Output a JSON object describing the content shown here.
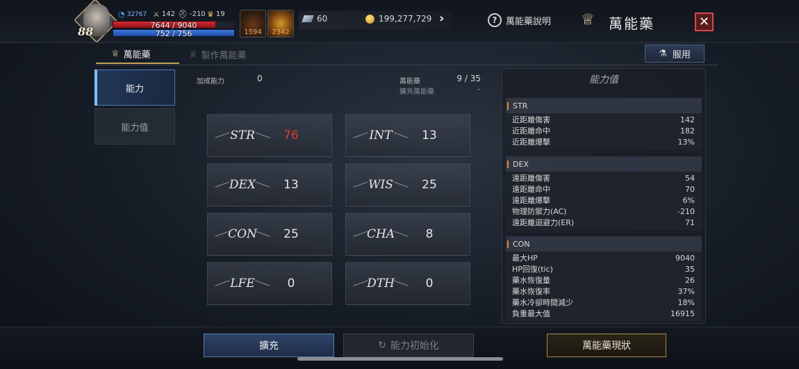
{
  "player": {
    "level": "88",
    "exp": "32767",
    "ac": "142",
    "mr": "-210",
    "trophy": "19",
    "hp_text": "7644 / 9040",
    "hp_fraction": 0.846,
    "mp_text": "752 / 756",
    "mp_fraction": 0.995
  },
  "slots": [
    {
      "icon": "potion-red-icon",
      "count": "1594"
    },
    {
      "icon": "potion-gold-icon",
      "count": "2342"
    }
  ],
  "currency": {
    "gem": "60",
    "gold": "199,277,729"
  },
  "header": {
    "help_label": "萬能藥說明",
    "title": "萬能藥"
  },
  "tabs": [
    {
      "label": "萬能藥",
      "active": true
    },
    {
      "label": "製作萬能藥",
      "active": false
    }
  ],
  "use_button": "服用",
  "side_menu": [
    {
      "label": "能力",
      "active": true
    },
    {
      "label": "能力值",
      "active": false
    }
  ],
  "info": {
    "bonus_label": "加成能力",
    "bonus_value": "0",
    "elixir_label": "萬能藥",
    "elixir_value": "9 / 35",
    "expand_label": "擴充萬能藥",
    "expand_value": "-"
  },
  "stats": [
    {
      "name": "STR",
      "value": "76",
      "highlight": true
    },
    {
      "name": "INT",
      "value": "13",
      "highlight": false
    },
    {
      "name": "DEX",
      "value": "13",
      "highlight": false
    },
    {
      "name": "WIS",
      "value": "25",
      "highlight": false
    },
    {
      "name": "CON",
      "value": "25",
      "highlight": false
    },
    {
      "name": "CHA",
      "value": "8",
      "highlight": false
    },
    {
      "name": "LFE",
      "value": "0",
      "highlight": false
    },
    {
      "name": "DTH",
      "value": "0",
      "highlight": false
    }
  ],
  "ability_panel": {
    "title": "能力值",
    "groups": [
      {
        "name": "STR",
        "rows": [
          {
            "label": "近距離傷害",
            "value": "142"
          },
          {
            "label": "近距離命中",
            "value": "182"
          },
          {
            "label": "近距離爆擊",
            "value": "13%"
          }
        ]
      },
      {
        "name": "DEX",
        "rows": [
          {
            "label": "遠距離傷害",
            "value": "54"
          },
          {
            "label": "遠距離命中",
            "value": "70"
          },
          {
            "label": "遠距離爆擊",
            "value": "6%"
          },
          {
            "label": "物理防禦力(AC)",
            "value": "-210"
          },
          {
            "label": "遠距離迴避力(ER)",
            "value": "71"
          }
        ]
      },
      {
        "name": "CON",
        "rows": [
          {
            "label": "最大HP",
            "value": "9040"
          },
          {
            "label": "HP回復(tic)",
            "value": "35"
          },
          {
            "label": "藥水恢復量",
            "value": "26"
          },
          {
            "label": "藥水恢復率",
            "value": "37%"
          },
          {
            "label": "藥水冷卻時間減少",
            "value": "18%"
          },
          {
            "label": "負重最大值",
            "value": "16915"
          }
        ]
      }
    ]
  },
  "bottom": {
    "expand": "擴充",
    "reset": "能力初始化",
    "status": "萬能藥現狀"
  },
  "colors": {
    "accent_blue": "#4f7cc4",
    "highlight_red": "#e03a3a",
    "gold_border": "#a88a4c",
    "close_red": "#d64a4a"
  }
}
